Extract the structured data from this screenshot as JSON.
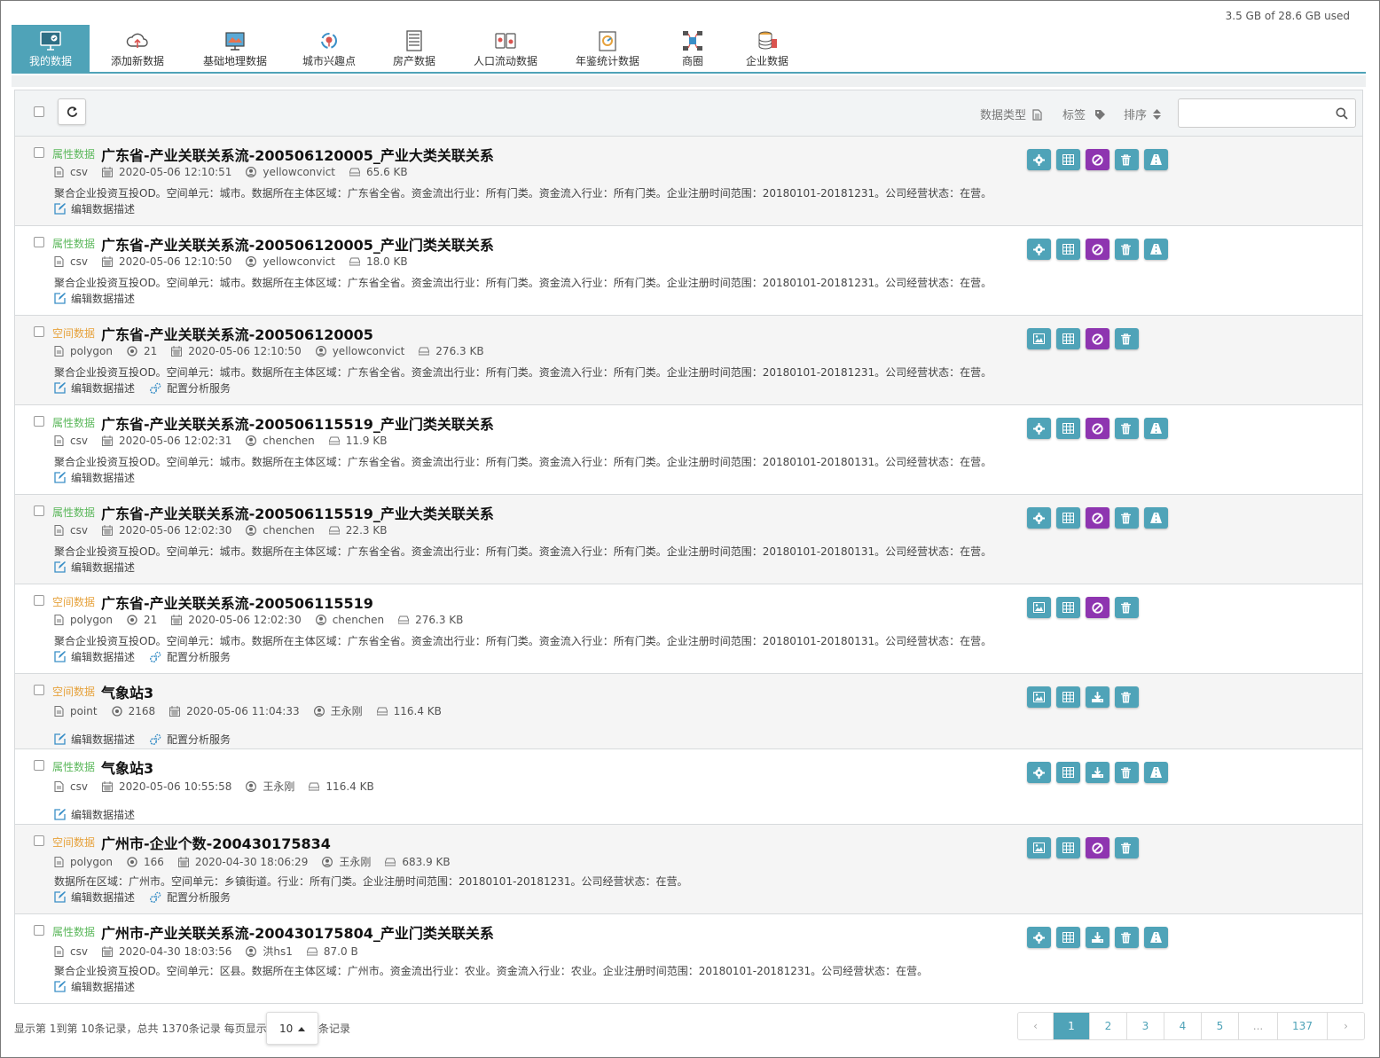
{
  "storage": "3.5 GB of 28.6 GB used",
  "nav": [
    {
      "label": "我的数据",
      "icon": "monitor-icon",
      "active": true
    },
    {
      "label": "添加新数据",
      "icon": "cloud-upload-icon"
    },
    {
      "label": "基础地理数据",
      "icon": "map-screen-icon"
    },
    {
      "label": "城市兴趣点",
      "icon": "poi-cycle-icon"
    },
    {
      "label": "房产数据",
      "icon": "building-icon"
    },
    {
      "label": "人口流动数据",
      "icon": "population-flow-icon"
    },
    {
      "label": "年鉴统计数据",
      "icon": "yearbook-chart-icon"
    },
    {
      "label": "商圈",
      "icon": "network-icon"
    },
    {
      "label": "企业数据",
      "icon": "database-icon"
    }
  ],
  "toolbar": {
    "data_type": "数据类型",
    "tag": "标签",
    "sort": "排序",
    "search_placeholder": ""
  },
  "labels": {
    "edit_desc": "编辑数据描述",
    "config_service": "配置分析服务"
  },
  "rows": [
    {
      "kind": "属性数据",
      "title": "广东省-产业关联关系流-200506120005_产业大类关联关系",
      "format": "csv",
      "date": "2020-05-06 12:10:51",
      "user": "yellowconvict",
      "size": "65.6 KB",
      "desc": "聚合企业投资互投OD。空间单元：城市。数据所在主体区域：广东省全省。资金流出行业：所有门类。资金流入行业：所有门类。企业注册时间范围：20180101-20181231。公司经营状态：在营。"
    },
    {
      "kind": "属性数据",
      "title": "广东省-产业关联关系流-200506120005_产业门类关联关系",
      "format": "csv",
      "date": "2020-05-06 12:10:50",
      "user": "yellowconvict",
      "size": "18.0 KB",
      "desc": "聚合企业投资互投OD。空间单元：城市。数据所在主体区域：广东省全省。资金流出行业：所有门类。资金流入行业：所有门类。企业注册时间范围：20180101-20181231。公司经营状态：在营。"
    },
    {
      "kind": "空间数据",
      "title": "广东省-产业关联关系流-200506120005",
      "format": "polygon",
      "count": "21",
      "date": "2020-05-06 12:10:50",
      "user": "yellowconvict",
      "size": "276.3 KB",
      "desc": "聚合企业投资互投OD。空间单元：城市。数据所在主体区域：广东省全省。资金流出行业：所有门类。资金流入行业：所有门类。企业注册时间范围：20180101-20181231。公司经营状态：在营。"
    },
    {
      "kind": "属性数据",
      "title": "广东省-产业关联关系流-200506115519_产业门类关联关系",
      "format": "csv",
      "date": "2020-05-06 12:02:31",
      "user": "chenchen",
      "size": "11.9 KB",
      "desc": "聚合企业投资互投OD。空间单元：城市。数据所在主体区域：广东省全省。资金流出行业：所有门类。资金流入行业：所有门类。企业注册时间范围：20180101-20180131。公司经营状态：在营。"
    },
    {
      "kind": "属性数据",
      "title": "广东省-产业关联关系流-200506115519_产业大类关联关系",
      "format": "csv",
      "date": "2020-05-06 12:02:30",
      "user": "chenchen",
      "size": "22.3 KB",
      "desc": "聚合企业投资互投OD。空间单元：城市。数据所在主体区域：广东省全省。资金流出行业：所有门类。资金流入行业：所有门类。企业注册时间范围：20180101-20180131。公司经营状态：在营。"
    },
    {
      "kind": "空间数据",
      "title": "广东省-产业关联关系流-200506115519",
      "format": "polygon",
      "count": "21",
      "date": "2020-05-06 12:02:30",
      "user": "chenchen",
      "size": "276.3 KB",
      "desc": "聚合企业投资互投OD。空间单元：城市。数据所在主体区域：广东省全省。资金流出行业：所有门类。资金流入行业：所有门类。企业注册时间范围：20180101-20180131。公司经营状态：在营。"
    },
    {
      "kind": "空间数据",
      "title": "气象站3",
      "format": "point",
      "count": "2168",
      "date": "2020-05-06 11:04:33",
      "user": "王永刚",
      "size": "116.4 KB",
      "desc": ""
    },
    {
      "kind": "属性数据",
      "title": "气象站3",
      "format": "csv",
      "date": "2020-05-06 10:55:58",
      "user": "王永刚",
      "size": "116.4 KB",
      "desc": ""
    },
    {
      "kind": "空间数据",
      "title": "广州市-企业个数-200430175834",
      "format": "polygon",
      "count": "166",
      "date": "2020-04-30 18:06:29",
      "user": "王永刚",
      "size": "683.9 KB",
      "desc": "数据所在区域：广州市。空间单元：乡镇街道。行业：所有门类。企业注册时间范围：20180101-20181231。公司经营状态：在营。"
    },
    {
      "kind": "属性数据",
      "title": "广州市-产业关联关系流-200430175804_产业门类关联关系",
      "format": "csv",
      "date": "2020-04-30 18:03:56",
      "user": "洪hs1",
      "size": "87.0 B",
      "desc": "聚合企业投资互投OD。空间单元：区县。数据所在主体区域：广州市。资金流出行业：农业。资金流入行业：农业。企业注册时间范围：20180101-20181231。公司经营状态：在营。"
    }
  ],
  "footer": {
    "summary": "显示第 1到第 10条记录，总共 1370条记录 每页显示",
    "page_size": "10",
    "suffix": "条记录",
    "pages": [
      "‹",
      "1",
      "2",
      "3",
      "4",
      "5",
      "...",
      "137",
      "›"
    ]
  },
  "colors": {
    "teal": "#4fa3b8",
    "purple": "#8e35b0",
    "attr_tag": "#5cb85c",
    "space_tag": "#e6a23c"
  }
}
